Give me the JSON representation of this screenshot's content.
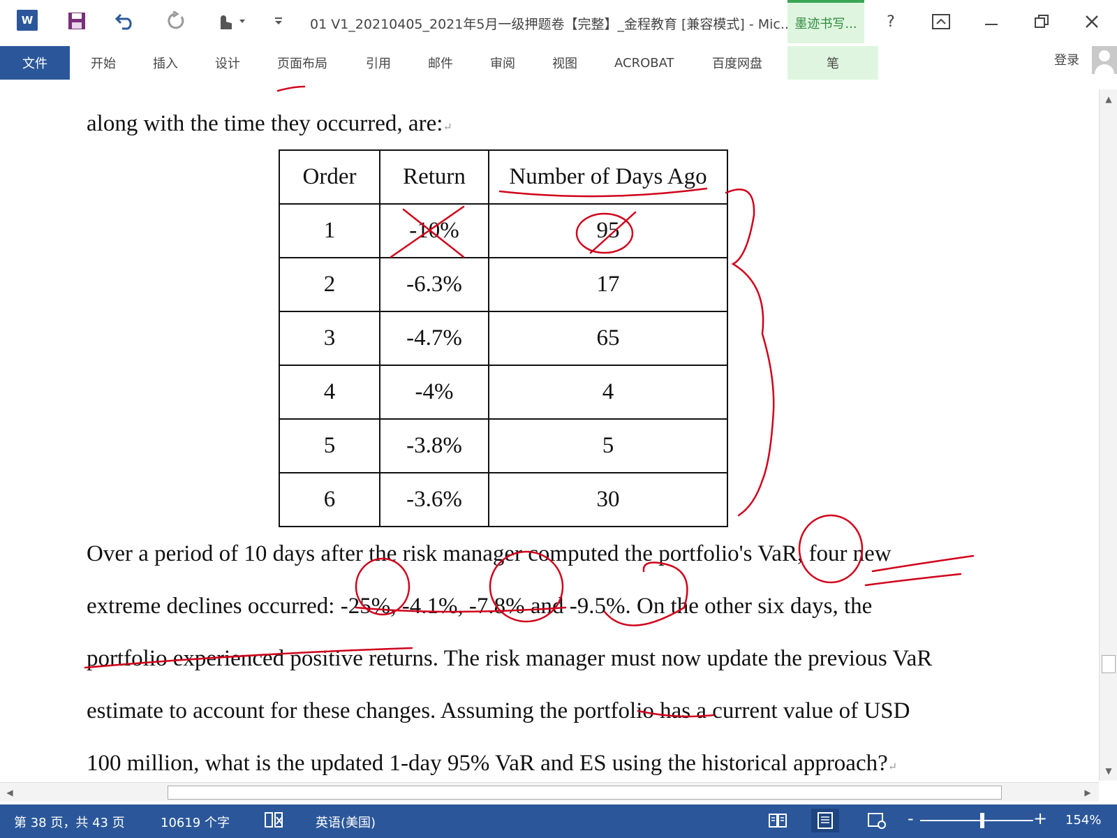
{
  "window": {
    "title": "01 V1_20210405_2021年5月一级押题卷【完整】_金程教育 [兼容模式] - Mic...",
    "ink_tab": "墨迹书写...",
    "help": "?",
    "logo": "W"
  },
  "ribbon": {
    "tabs": [
      "文件",
      "开始",
      "插入",
      "设计",
      "页面布局",
      "引用",
      "邮件",
      "审阅",
      "视图",
      "ACROBAT",
      "百度网盘",
      "笔"
    ],
    "login": "登录"
  },
  "document": {
    "intro": "along with the time they occurred, are:",
    "table": {
      "headers": [
        "Order",
        "Return",
        "Number of Days Ago"
      ],
      "rows": [
        [
          "1",
          "-10%",
          "95"
        ],
        [
          "2",
          "-6.3%",
          "17"
        ],
        [
          "3",
          "-4.7%",
          "65"
        ],
        [
          "4",
          "-4%",
          "4"
        ],
        [
          "5",
          "-3.8%",
          "5"
        ],
        [
          "6",
          "-3.6%",
          "30"
        ]
      ]
    },
    "lines": [
      "Over a period of 10 days after the risk manager computed the portfolio's VaR, four new",
      "extreme declines occurred: -25%, -4.1%, -7.8% and -9.5%. On the other six days, the",
      "portfolio experienced positive returns. The risk manager must now update the previous VaR",
      "estimate to account for these changes. Assuming the portfolio has a current value of USD",
      "100 million, what is the updated 1-day 95% VaR and ES using the historical approach?"
    ]
  },
  "statusbar": {
    "page": "第 38 页，共 43 页",
    "words": "10619 个字",
    "language": "英语(美国)",
    "zoom_minus": "-",
    "zoom_plus": "+",
    "zoom": "154%"
  },
  "colors": {
    "accent": "#2b579a",
    "ink": "#d0021b",
    "ink_tab": "#dff5df"
  }
}
